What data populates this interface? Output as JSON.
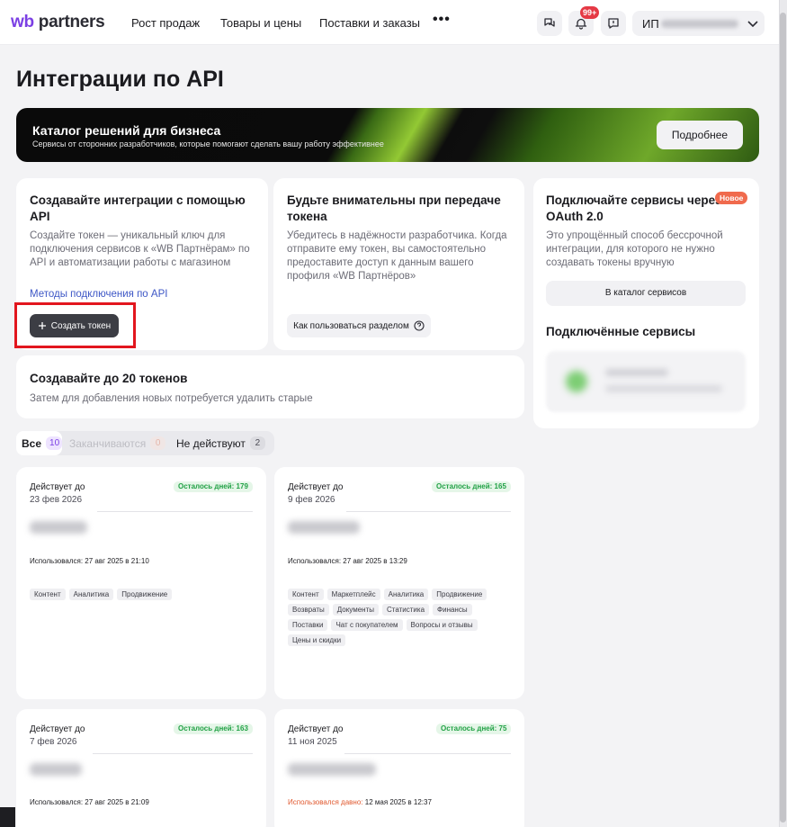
{
  "header": {
    "logo_wb": "wb",
    "logo_partners": "partners",
    "nav": [
      "Рост продаж",
      "Товары и цены",
      "Поставки и заказы"
    ],
    "more": "•••",
    "notifications_badge": "99+",
    "profile_prefix": "ИП"
  },
  "page_title": "Интеграции по API",
  "banner": {
    "title": "Каталог решений для бизнеса",
    "subtitle": "Сервисы от сторонних разработчиков, которые помогают сделать вашу работу эффективнее",
    "button": "Подробнее"
  },
  "card_create": {
    "title": "Создавайте интеграции с помощью API",
    "text": "Создайте токен — уникальный ключ для подключения сервисов к «WB Партнёрам» по API и автоматизации работы с магазином",
    "link": "Методы подключения по API",
    "button": "Создать токен"
  },
  "card_attention": {
    "title": "Будьте внимательны при передаче токена",
    "text": "Убедитесь в надёжности разработчика. Когда отправите ему токен, вы самостоятельно предоставите доступ к данным вашего профиля «WB Партнёров»",
    "button": "Как пользоваться разделом"
  },
  "card_oauth": {
    "title": "Подключайте сервисы через OAuth 2.0",
    "badge": "Новое",
    "text": "Это упрощённый способ бессрочной интеграции, для которого не нужно создавать токены вручную",
    "button": "В каталог сервисов",
    "connected_title": "Подключённые сервисы"
  },
  "card_limit": {
    "title": "Создавайте до 20 токенов",
    "text": "Затем для добавления новых потребуется удалить старые"
  },
  "tabs": [
    {
      "label": "Все",
      "count": "10"
    },
    {
      "label": "Заканчиваются",
      "count": "0"
    },
    {
      "label": "Не действуют",
      "count": "2"
    }
  ],
  "tokens": [
    {
      "valid_until_label": "Действует до",
      "date": "23 фев 2026",
      "days_left": "Осталось дней: 179",
      "used_label": "Использовался:",
      "used": "27 авг 2025 в 21:10",
      "tags": [
        "Контент",
        "Аналитика",
        "Продвижение"
      ]
    },
    {
      "valid_until_label": "Действует до",
      "date": "9 фев 2026",
      "days_left": "Осталось дней: 165",
      "used_label": "Использовался:",
      "used": "27 авг 2025 в 13:29",
      "tags": [
        "Контент",
        "Маркетплейс",
        "Аналитика",
        "Продвижение",
        "Возвраты",
        "Документы",
        "Статистика",
        "Финансы",
        "Поставки",
        "Чат с покупателем",
        "Вопросы и отзывы",
        "Цены и скидки"
      ]
    },
    {
      "valid_until_label": "Действует до",
      "date": "7 фев 2026",
      "days_left": "Осталось дней: 163",
      "used_label": "Использовался:",
      "used": "27 авг 2025 в 21:09"
    },
    {
      "valid_until_label": "Действует до",
      "date": "11 ноя 2025",
      "days_left": "Осталось дней: 75",
      "used_label": "Использовался давно:",
      "used": "12 мая 2025 в 12:37"
    }
  ],
  "colors": {
    "accent_purple": "#7b3fe4",
    "days_green": "#21a145",
    "link_blue": "#3e57c6",
    "highlight_red": "#e2161e",
    "new_badge": "#f06a4d"
  }
}
